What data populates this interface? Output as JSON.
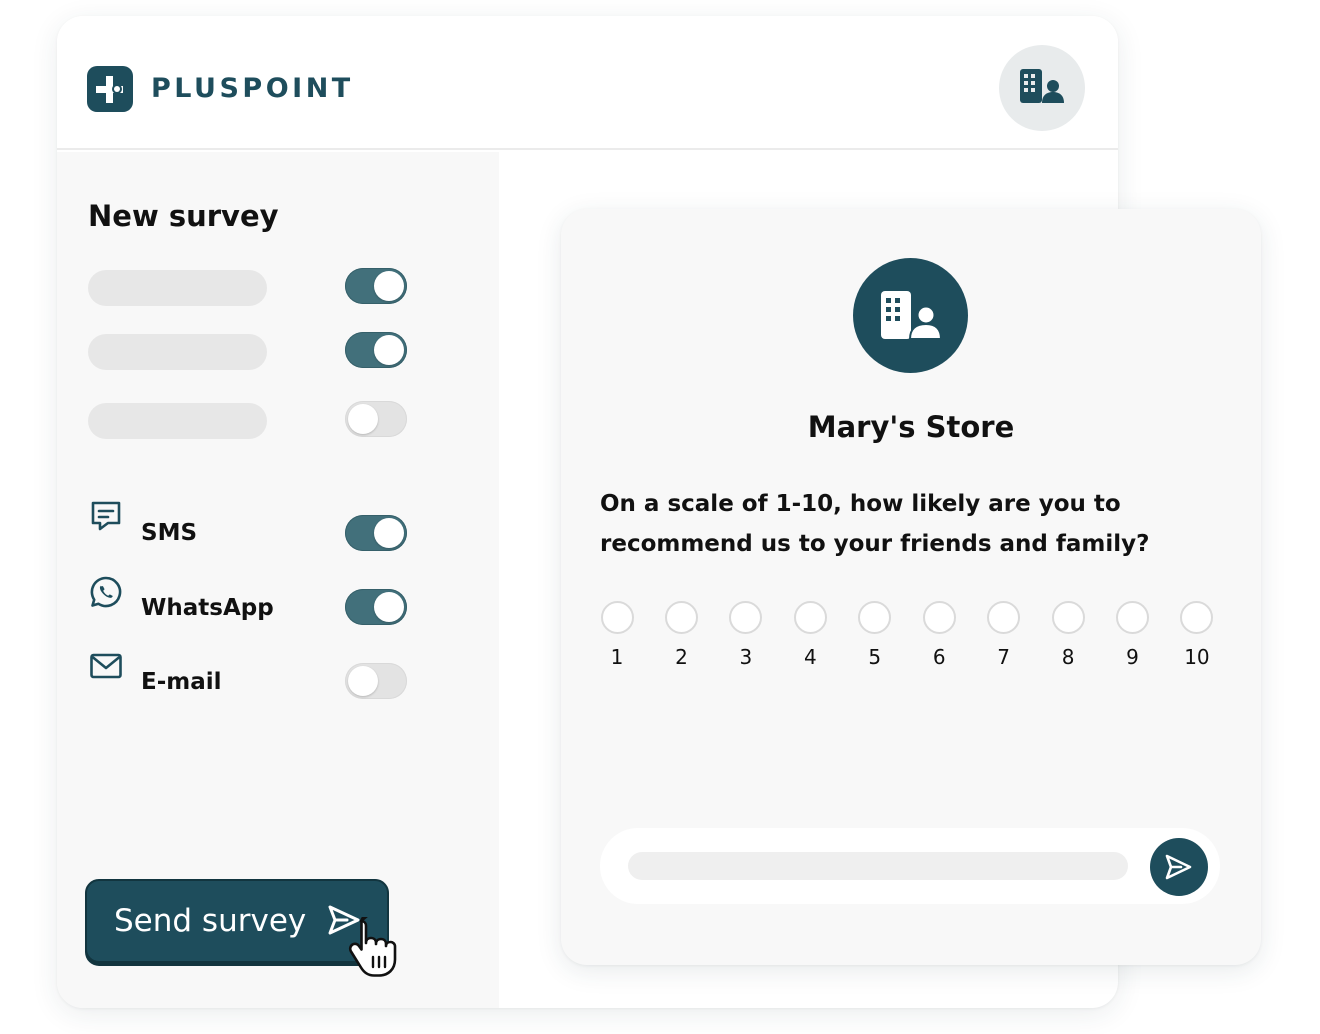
{
  "header": {
    "brand": "PLUSPOINT",
    "logo_icon": "plus-cross-icon",
    "avatar_icon": "building-user-icon"
  },
  "sidebar": {
    "title": "New survey",
    "placeholder_toggles": [
      {
        "on": true
      },
      {
        "on": true
      },
      {
        "on": false
      }
    ],
    "channels": [
      {
        "label": "SMS",
        "icon": "sms-icon",
        "on": true
      },
      {
        "label": "WhatsApp",
        "icon": "whatsapp-icon",
        "on": true
      },
      {
        "label": "E-mail",
        "icon": "email-icon",
        "on": false
      }
    ],
    "send_label": "Send survey"
  },
  "survey": {
    "store_name": "Mary's Store",
    "question": "On a scale of 1-10, how likely are you to recommend us to your friends and family?",
    "scale": [
      "1",
      "2",
      "3",
      "4",
      "5",
      "6",
      "7",
      "8",
      "9",
      "10"
    ]
  },
  "colors": {
    "brand": "#1e4d5c",
    "toggle_on": "#42707b",
    "toggle_off": "#e3e3e3",
    "panel": "#f8f8f8"
  }
}
